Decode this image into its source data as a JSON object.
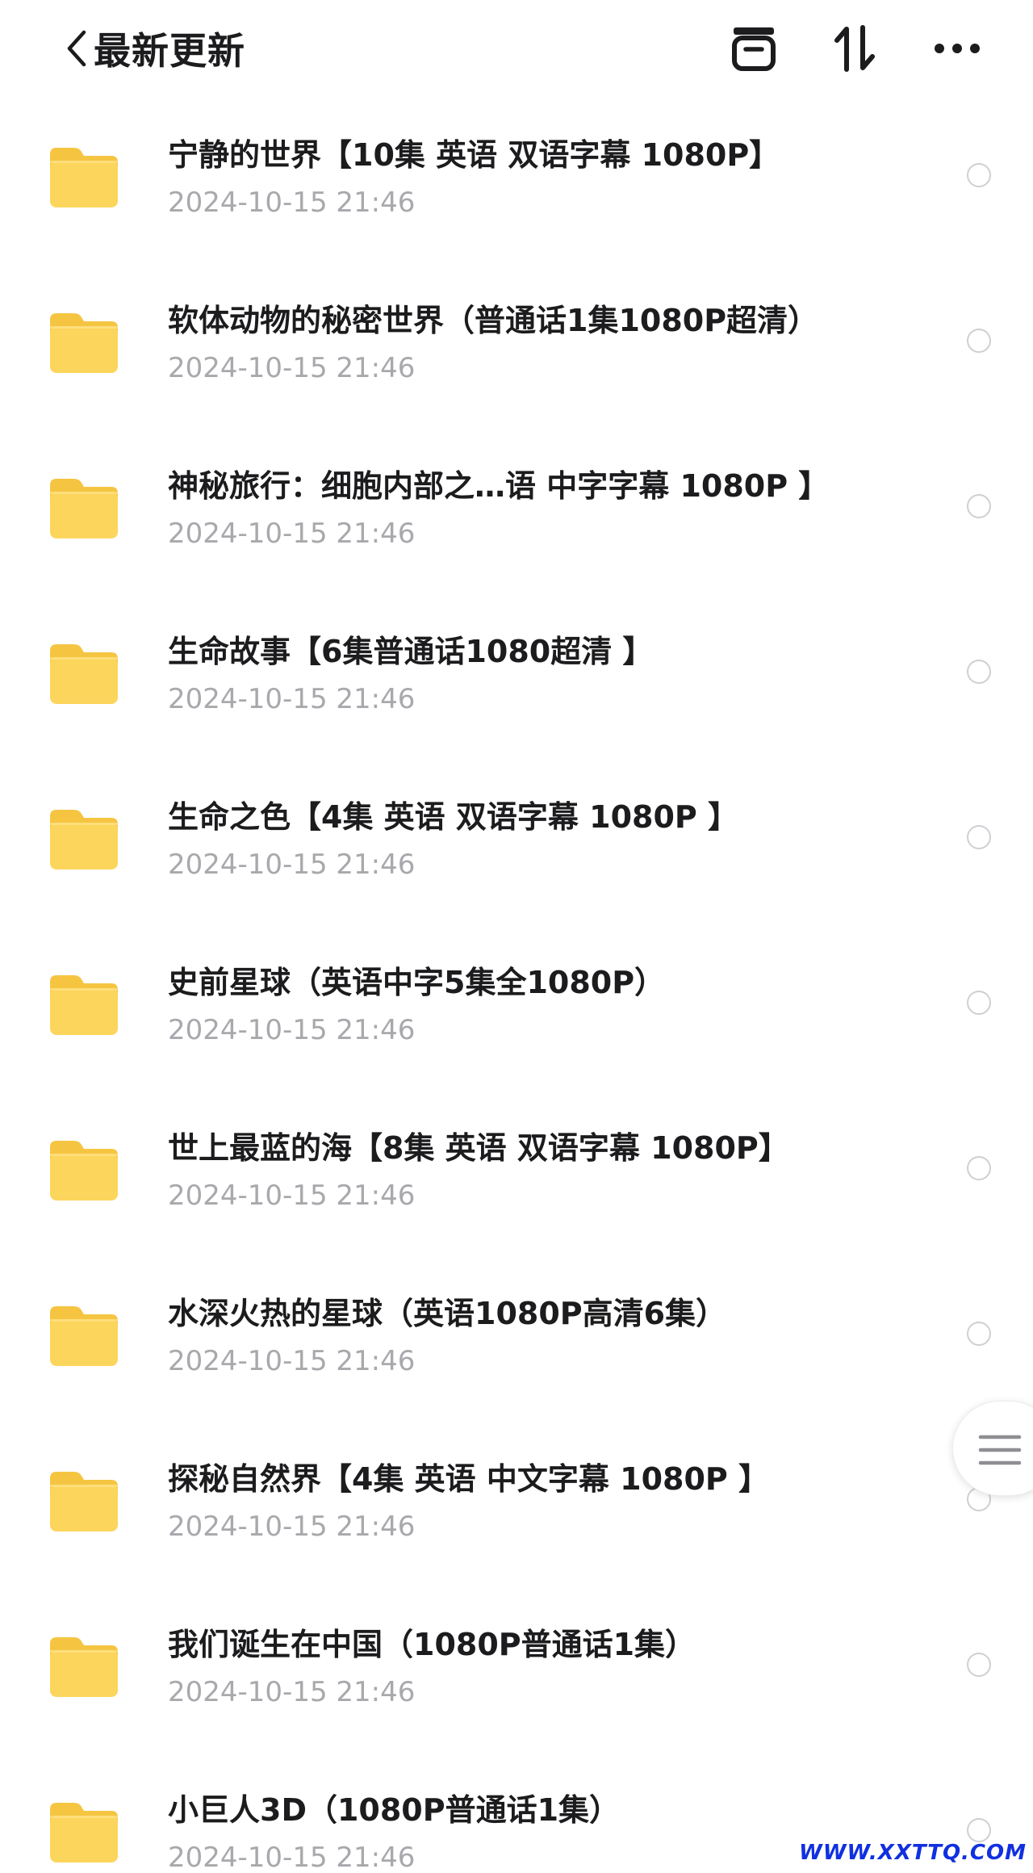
{
  "header": {
    "title": "最新更新",
    "icons": [
      "back-chevron-icon",
      "archive-box-icon",
      "sort-arrows-icon",
      "more-dots-icon"
    ]
  },
  "folders": [
    {
      "name": "宁静的世界【10集 英语 双语字幕 1080P】",
      "date": "2024-10-15 21:46"
    },
    {
      "name": "软体动物的秘密世界（普通话1集1080P超清）",
      "date": "2024-10-15 21:46"
    },
    {
      "name": "神秘旅行：细胞内部之…语 中字字幕 1080P 】",
      "date": "2024-10-15 21:46"
    },
    {
      "name": "生命故事【6集普通话1080超清 】",
      "date": "2024-10-15 21:46"
    },
    {
      "name": "生命之色【4集 英语 双语字幕 1080P 】",
      "date": "2024-10-15 21:46"
    },
    {
      "name": "史前星球（英语中字5集全1080P）",
      "date": "2024-10-15 21:46"
    },
    {
      "name": "世上最蓝的海【8集 英语 双语字幕 1080P】",
      "date": "2024-10-15 21:46"
    },
    {
      "name": "水深火热的星球（英语1080P高清6集）",
      "date": "2024-10-15 21:46"
    },
    {
      "name": "探秘自然界【4集 英语 中文字幕 1080P 】",
      "date": "2024-10-15 21:46"
    },
    {
      "name": "我们诞生在中国（1080P普通话1集）",
      "date": "2024-10-15 21:46"
    },
    {
      "name": "小巨人3D（1080P普通话1集）",
      "date": "2024-10-15 21:46"
    }
  ],
  "colors": {
    "folder_body": "#FCD55C",
    "folder_tab": "#F5C542",
    "title_text": "#1c1c1e",
    "date_text": "#a8a8ad",
    "radio_border": "#cfcfd4",
    "watermark": "#1030e0"
  },
  "watermark": "WWW.XXTTQ.COM"
}
